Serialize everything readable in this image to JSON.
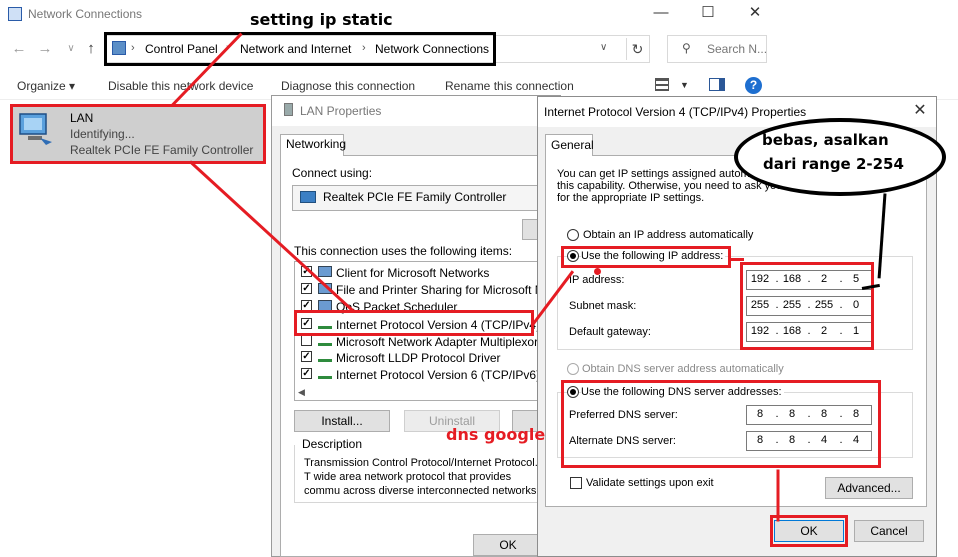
{
  "explorer": {
    "title": "Network Connections",
    "breadcrumb": [
      "Control Panel",
      "Network and Internet",
      "Network Connections"
    ],
    "search_placeholder": "Search N...",
    "commands": [
      "Organize ▾",
      "Disable this network device",
      "Diagnose this connection",
      "Rename this connection"
    ],
    "lan": {
      "name": "LAN",
      "status": "Identifying...",
      "adapter": "Realtek PCIe FE Family Controller"
    }
  },
  "lan_properties": {
    "title": "LAN Properties",
    "tab": "Networking",
    "connect_using": "Connect using:",
    "adapter": "Realtek PCIe FE Family Controller",
    "items_label": "This connection uses the following items:",
    "items": [
      {
        "label": "Client for Microsoft Networks",
        "checked": true,
        "icon": "network-client-icon"
      },
      {
        "label": "File and Printer Sharing for Microsoft Netwo",
        "checked": true,
        "icon": "file-printer-sharing-icon"
      },
      {
        "label": "QoS Packet Scheduler",
        "checked": true,
        "icon": "qos-scheduler-icon"
      },
      {
        "label": "Internet Protocol Version 4 (TCP/IPv4)",
        "checked": true,
        "icon": "protocol-icon"
      },
      {
        "label": "Microsoft Network Adapter Multiplexor Prot",
        "checked": false,
        "icon": "protocol-icon"
      },
      {
        "label": "Microsoft LLDP Protocol Driver",
        "checked": true,
        "icon": "protocol-icon"
      },
      {
        "label": "Internet Protocol Version 6 (TCP/IPv6)",
        "checked": true,
        "icon": "protocol-icon"
      }
    ],
    "install_label": "Install...",
    "uninstall_label": "Uninstall",
    "description_title": "Description",
    "description_text": "Transmission Control Protocol/Internet Protocol. T wide area network protocol that provides commu across diverse interconnected networks.",
    "ok_label": "OK"
  },
  "ipv4": {
    "title": "Internet Protocol Version 4 (TCP/IPv4) Properties",
    "tab": "General",
    "description": "You can get IP settings assigned automatically if your network supports this capability. Otherwise, you need to ask your network administrator for the appropriate IP settings.",
    "obtain_auto": "Obtain an IP address automatically",
    "use_following": "Use the following IP address:",
    "ip_label": "IP address:",
    "subnet_label": "Subnet mask:",
    "gateway_label": "Default gateway:",
    "ip": [
      "192",
      "168",
      "2",
      "5"
    ],
    "subnet": [
      "255",
      "255",
      "255",
      "0"
    ],
    "gateway": [
      "192",
      "168",
      "2",
      "1"
    ],
    "dns_auto": "Obtain DNS server address automatically",
    "dns_use": "Use the following DNS server addresses:",
    "preferred_label": "Preferred DNS server:",
    "alternate_label": "Alternate DNS server:",
    "preferred": [
      "8",
      "8",
      "8",
      "8"
    ],
    "alternate": [
      "8",
      "8",
      "4",
      "4"
    ],
    "validate": "Validate settings upon exit",
    "advanced_label": "Advanced...",
    "ok_label": "OK",
    "cancel_label": "Cancel"
  },
  "annotations": {
    "setting_static": "setting ip static",
    "dns_google": "dns google",
    "bubble_line1": "bebas, asalkan",
    "bubble_line2": "dari range 2-254"
  },
  "colors": {
    "annotation_red": "#e51c23",
    "selection_gray": "#cfcfcf"
  }
}
